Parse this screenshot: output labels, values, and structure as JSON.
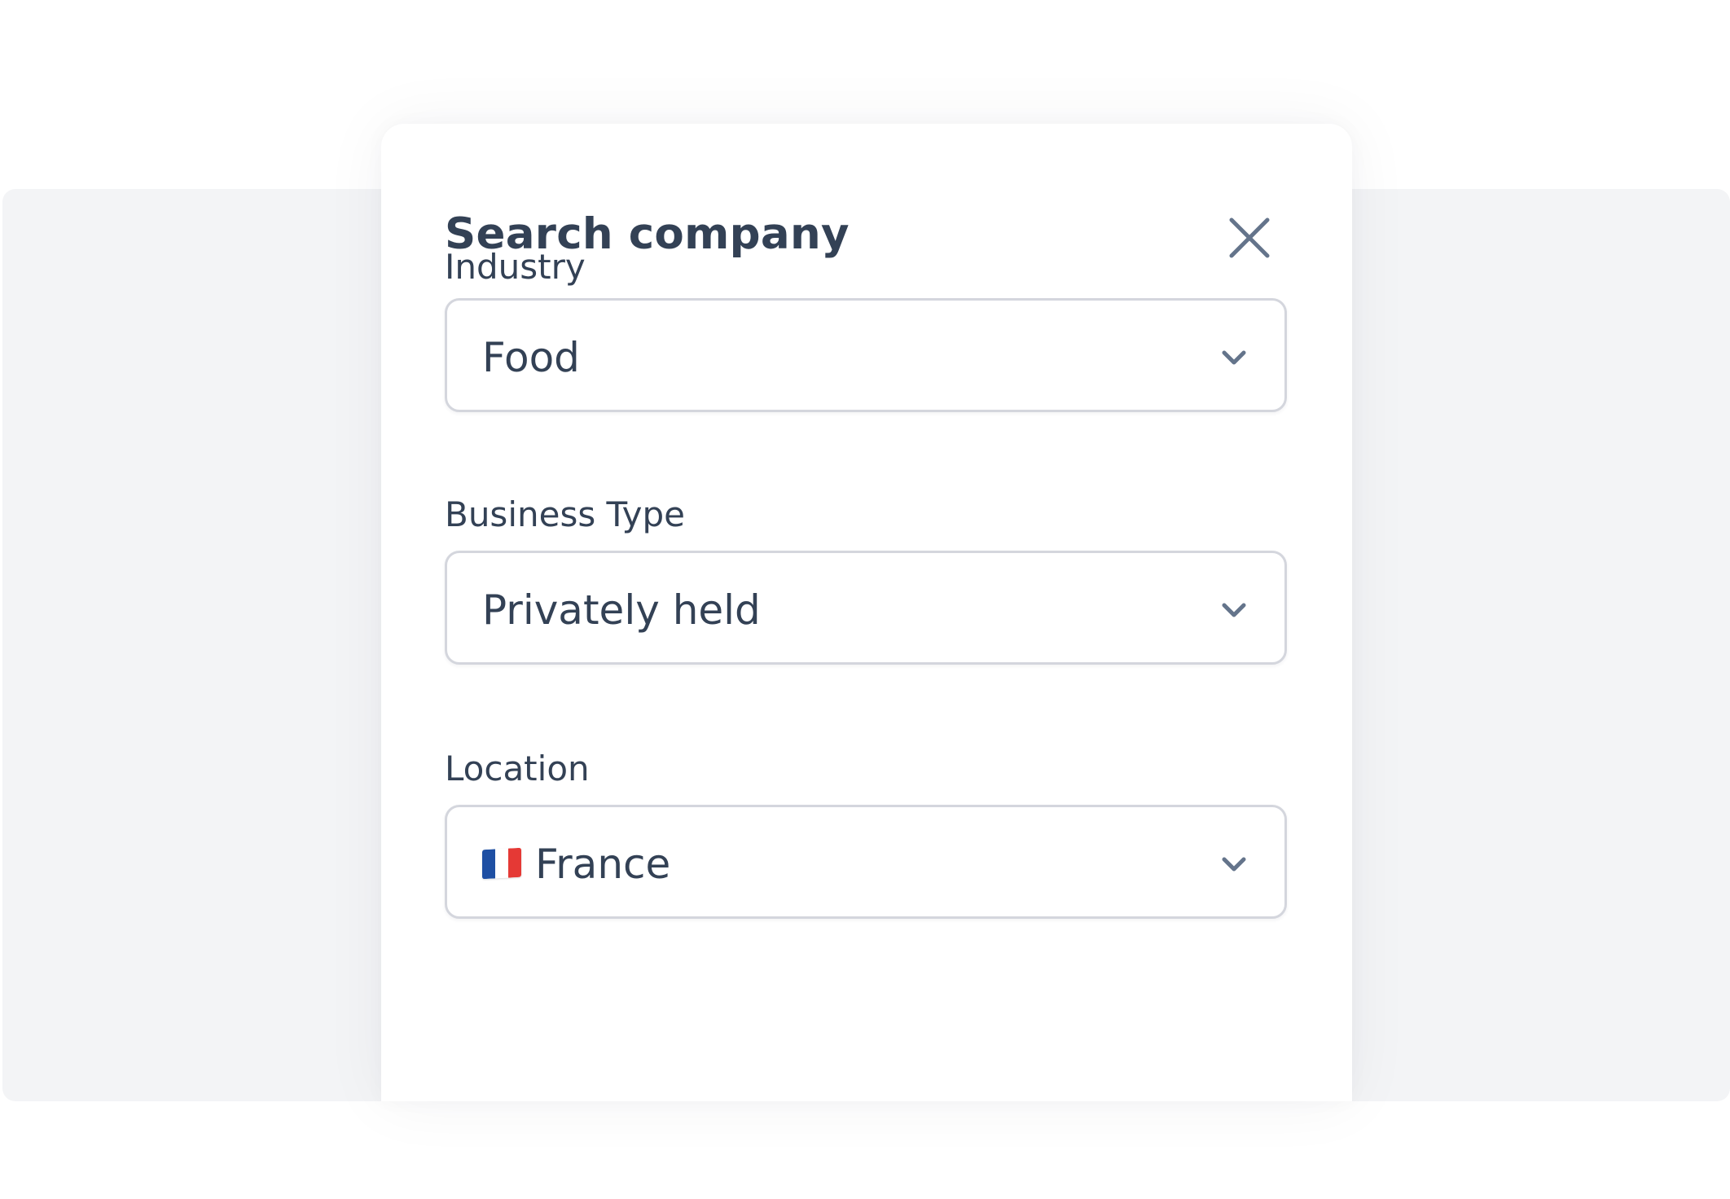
{
  "modal": {
    "title": "Search company"
  },
  "fields": {
    "industry": {
      "label": "Industry",
      "value": "Food"
    },
    "business_type": {
      "label": "Business Type",
      "value": "Privately held"
    },
    "location": {
      "label": "Location",
      "value": "France",
      "flag": "france-flag-icon"
    }
  },
  "colors": {
    "text": "#334155",
    "icon": "#64748b",
    "border": "#d4d6dd",
    "backdrop": "#f3f4f6",
    "flag_blue": "#1e4fa3",
    "flag_white": "#ffffff",
    "flag_red": "#e53935"
  }
}
